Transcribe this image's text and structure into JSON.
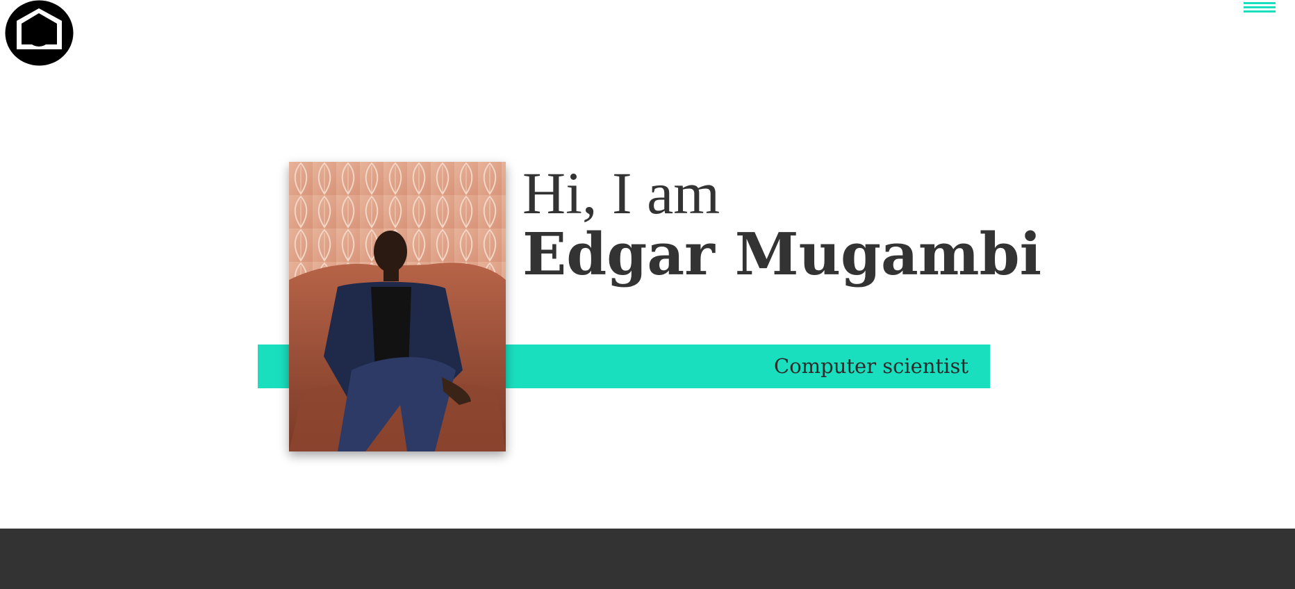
{
  "header": {
    "logo_icon": "home-icon",
    "menu_icon": "hamburger-menu-icon"
  },
  "hero": {
    "greeting": "Hi, I am",
    "name": "Edgar Mugambi",
    "role": "Computer scientist",
    "photo_alt": "Portrait photo"
  },
  "colors": {
    "accent": "#19dfbf",
    "text": "#333333",
    "footer": "#333333",
    "background": "#ffffff"
  }
}
